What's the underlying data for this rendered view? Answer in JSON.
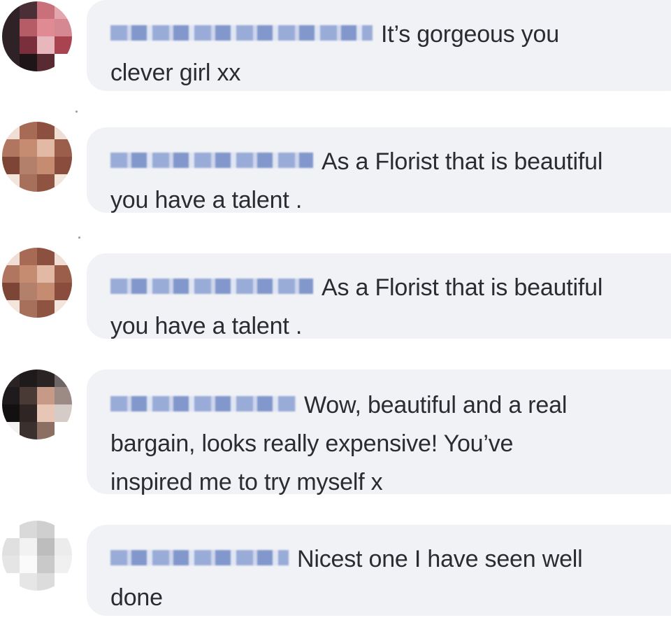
{
  "comments": [
    {
      "text_line1": "It’s gorgeous you",
      "text_line2": "clever girl xx",
      "colors": [
        "#3a2a2e",
        "#c9707a",
        "#e3a6ae",
        "#7b2f3c"
      ]
    },
    {
      "text_line1": "As a Florist that is beautiful",
      "text_line2": "you have a talent .",
      "colors": [
        "#a66a55",
        "#c58c72",
        "#7d4535",
        "#d9a78f"
      ]
    },
    {
      "text_line1": "As a Florist that is beautiful",
      "text_line2": "you have a talent .",
      "colors": [
        "#a66a55",
        "#c58c72",
        "#7d4535",
        "#d9a78f"
      ]
    },
    {
      "text_line1": "Wow, beautiful and a real",
      "text_line2": "bargain, looks really expensive! You’ve",
      "text_line3": "inspired me to try myself x",
      "colors": [
        "#1f1b1c",
        "#4a3a36",
        "#c69a86",
        "#e7c6b6"
      ]
    },
    {
      "text_line1": "Nicest one I have seen well",
      "text_line2": "done",
      "colors": [
        "#d9d9d9",
        "#f2f2f2",
        "#bdbdbd",
        "#ffffff"
      ]
    }
  ]
}
